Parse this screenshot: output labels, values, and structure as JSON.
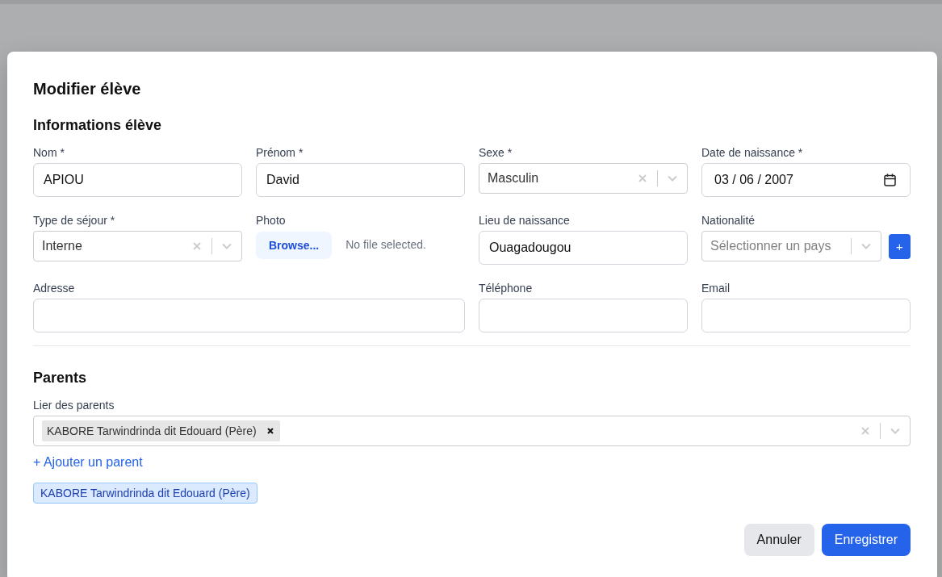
{
  "dialog": {
    "title": "Modifier élève",
    "sections": [
      {
        "kind": "form_grid",
        "title": "Informations élève",
        "fields": [
          {
            "kind": "text",
            "label": "Nom *",
            "value": "APIOU"
          },
          {
            "kind": "text",
            "label": "Prénom *",
            "value": "David"
          },
          {
            "kind": "select",
            "label": "Sexe *",
            "value": "Masculin"
          },
          {
            "kind": "date",
            "label": "Date de naissance *",
            "value": "03 / 06 / 2007"
          },
          {
            "kind": "select",
            "label": "Type de séjour *",
            "value": "Interne"
          },
          {
            "kind": "file",
            "label": "Photo",
            "button": "Browse...",
            "status": "No file selected."
          },
          {
            "kind": "text",
            "label": "Lieu de naissance",
            "value": "Ouagadougou"
          },
          {
            "kind": "select",
            "label": "Nationalité",
            "placeholder": "Sélectionner un pays",
            "add_button": "+"
          },
          {
            "kind": "text",
            "label": "Adresse",
            "wide": true
          },
          {
            "kind": "text",
            "label": "Téléphone"
          },
          {
            "kind": "text",
            "label": "Email"
          }
        ]
      },
      {
        "kind": "parents",
        "title": "Parents",
        "link_field": {
          "label": "Lier des parents",
          "tags": [
            "KABORE Tarwindrinda dit Edouard (Père)"
          ]
        },
        "add_link": "+ Ajouter un parent",
        "linked": [
          "KABORE Tarwindrinda dit Edouard (Père)"
        ]
      }
    ],
    "buttons": [
      {
        "label": "Annuler",
        "kind": "secondary"
      },
      {
        "label": "Enregistrer",
        "kind": "primary"
      }
    ]
  }
}
